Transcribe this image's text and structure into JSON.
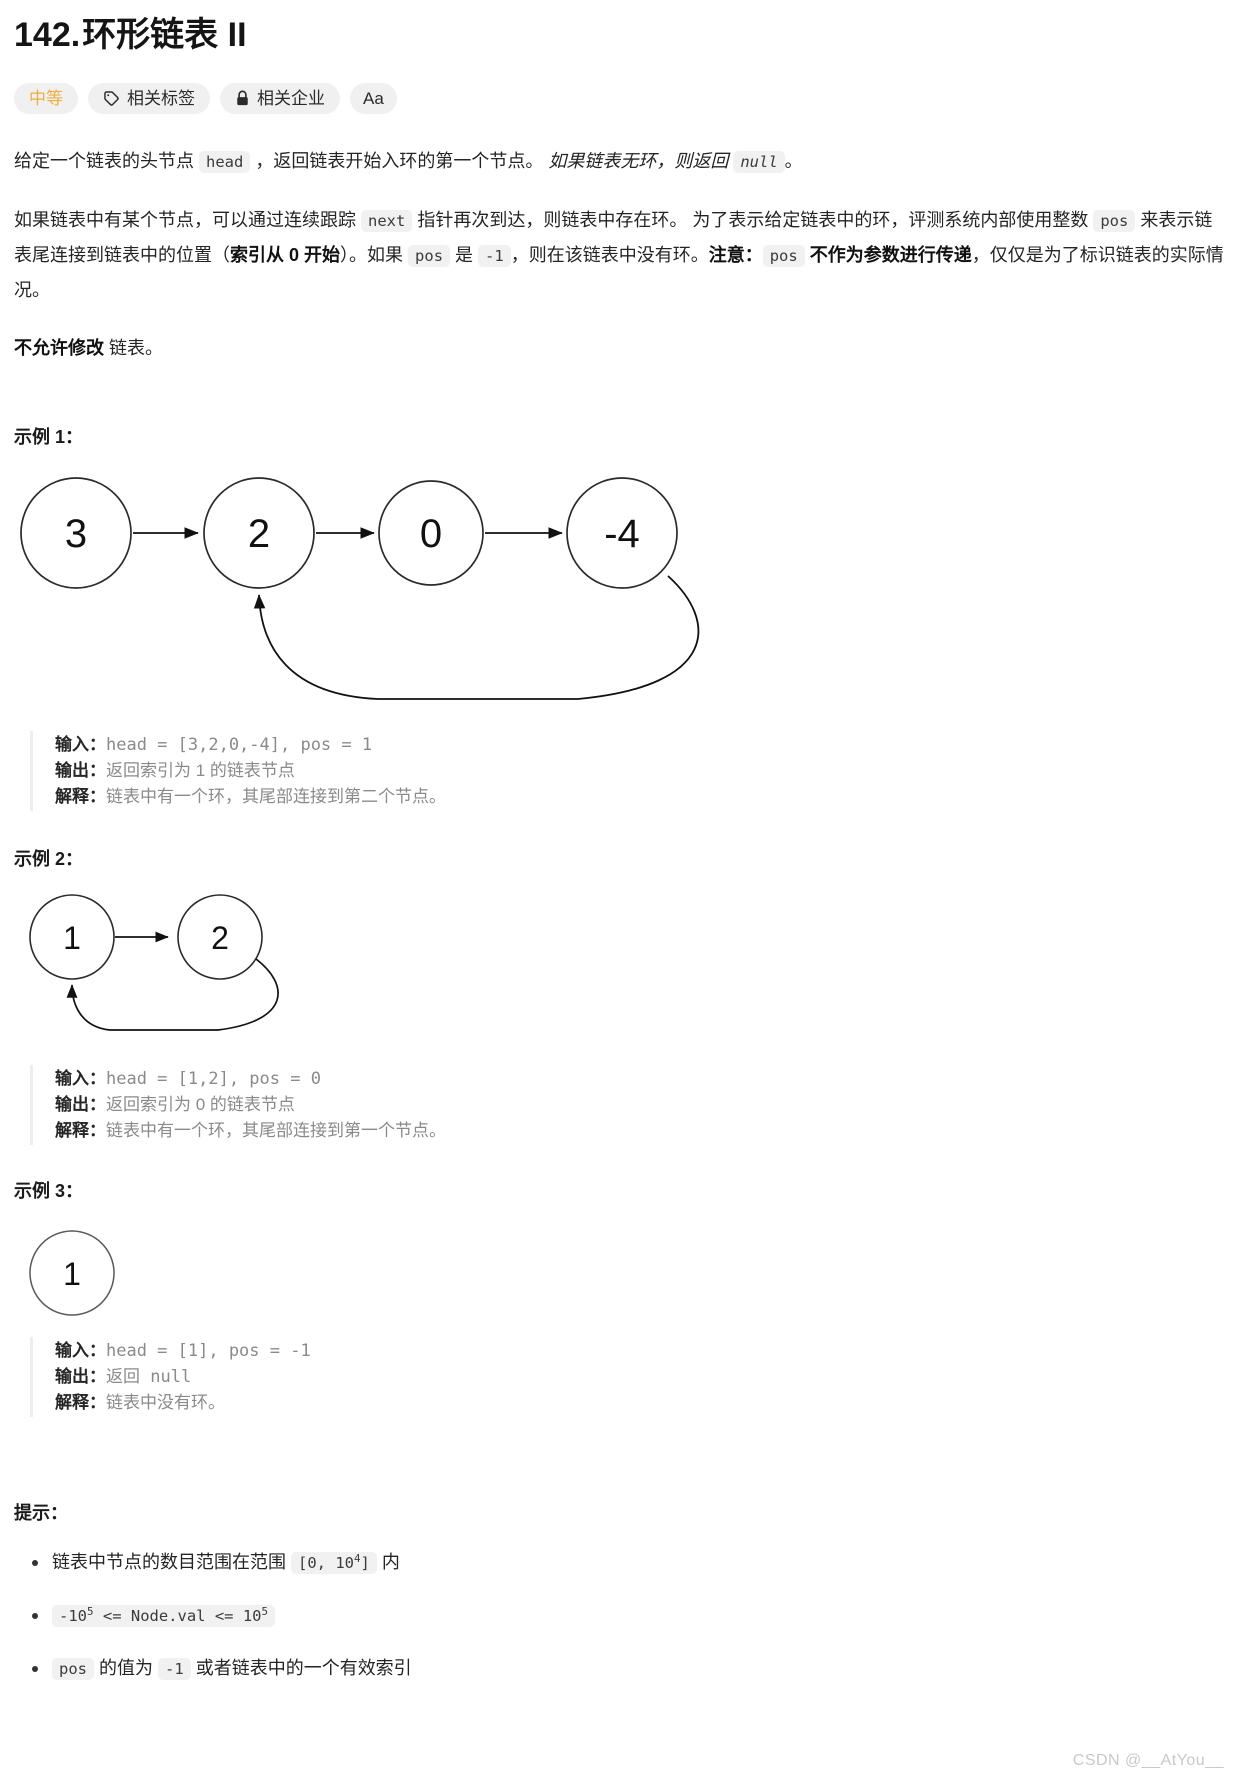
{
  "header": {
    "title_number": "142.",
    "title_text": "环形链表 II",
    "pills": [
      {
        "label": "中等",
        "icon": "none",
        "kind": "difficulty"
      },
      {
        "label": "相关标签",
        "icon": "tag-icon",
        "kind": "normal"
      },
      {
        "label": "相关企业",
        "icon": "lock-icon",
        "kind": "normal"
      },
      {
        "label": "Aa",
        "icon": "font-size-icon",
        "kind": "tiny"
      }
    ]
  },
  "description": {
    "p1": {
      "t1": "给定一个链表的头节点 ",
      "code1": "head",
      "t2": " ，返回链表开始入环的第一个节点。 ",
      "em1": "如果链表无环，则返回 ",
      "code2": "null",
      "t3": "。"
    },
    "p2": {
      "t1": "如果链表中有某个节点，可以通过连续跟踪 ",
      "code1": "next",
      "t2": " 指针再次到达，则链表中存在环。 为了表示给定链表中的环，评测系统内部使用整数 ",
      "code2": "pos",
      "t3": " 来表示链表尾连接到链表中的位置（",
      "b1": "索引从 0 开始",
      "t4": "）。如果 ",
      "code3": "pos",
      "t5": " 是 ",
      "code4": "-1",
      "t6": "，则在该链表中没有环。",
      "b2": "注意：",
      "code5": "pos",
      "b3": " 不作为参数进行传递",
      "t7": "，仅仅是为了标识链表的实际情况。"
    },
    "p3": {
      "b1": "不允许修改",
      "t1": " 链表。"
    }
  },
  "examples": [
    {
      "heading": "示例 1：",
      "diagram": {
        "type": "linked-list-cycle",
        "nodes": [
          "3",
          "2",
          "0",
          "-4"
        ],
        "cycle_from_index": 3,
        "cycle_to_index": 1
      },
      "lines": [
        {
          "label": "输入：",
          "value": "head = [3,2,0,-4], pos = 1",
          "mono": true
        },
        {
          "label": "输出：",
          "value": "返回索引为 1 的链表节点",
          "mono": false
        },
        {
          "label": "解释：",
          "value": "链表中有一个环，其尾部连接到第二个节点。",
          "mono": false
        }
      ]
    },
    {
      "heading": "示例 2：",
      "diagram": {
        "type": "linked-list-cycle",
        "nodes": [
          "1",
          "2"
        ],
        "cycle_from_index": 1,
        "cycle_to_index": 0
      },
      "lines": [
        {
          "label": "输入：",
          "value": "head = [1,2], pos = 0",
          "mono": true
        },
        {
          "label": "输出：",
          "value": "返回索引为 0 的链表节点",
          "mono": false
        },
        {
          "label": "解释：",
          "value": "链表中有一个环，其尾部连接到第一个节点。",
          "mono": false
        }
      ]
    },
    {
      "heading": "示例 3：",
      "diagram": {
        "type": "linked-list-cycle",
        "nodes": [
          "1"
        ],
        "cycle_from_index": -1,
        "cycle_to_index": -1
      },
      "lines": [
        {
          "label": "输入：",
          "value": "head = [1], pos = -1",
          "mono": true
        },
        {
          "label": "输出：",
          "value": "返回 null",
          "mono": true
        },
        {
          "label": "解释：",
          "value": "链表中没有环。",
          "mono": false
        }
      ]
    }
  ],
  "hints": {
    "heading": "提示：",
    "items": [
      {
        "parts": [
          {
            "type": "text",
            "value": "链表中节点的数目范围在范围 "
          },
          {
            "type": "code",
            "value": "[0, 10",
            "sup": "4",
            "tail": "]"
          },
          {
            "type": "text",
            "value": " 内"
          }
        ]
      },
      {
        "parts": [
          {
            "type": "code",
            "value": "-10",
            "sup": "5",
            "tail": " <= Node.val <= 10",
            "sup2": "5"
          }
        ]
      },
      {
        "parts": [
          {
            "type": "code",
            "value": "pos"
          },
          {
            "type": "text",
            "value": " 的值为 "
          },
          {
            "type": "code",
            "value": "-1"
          },
          {
            "type": "text",
            "value": " 或者链表中的一个有效索引"
          }
        ]
      }
    ]
  },
  "watermark": "CSDN @__AtYou__",
  "colors": {
    "difficulty": "#eeaf3f",
    "chip_bg": "#f1f1f1",
    "pill_bg": "#f0f0f0",
    "block_border": "#eeeeee",
    "text": "#242424",
    "muted": "#8a8a8a"
  }
}
